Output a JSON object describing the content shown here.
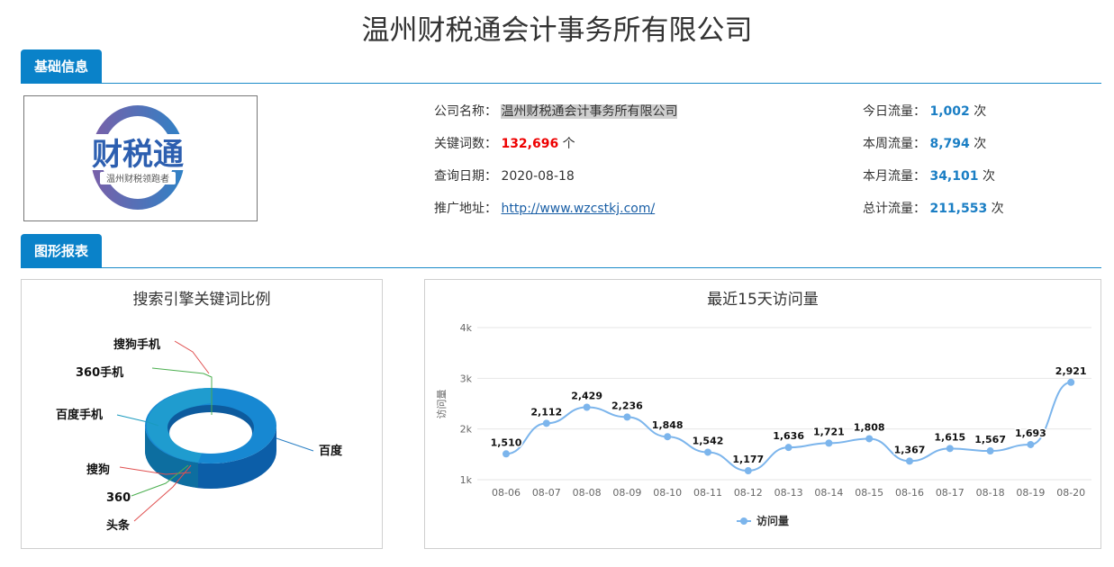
{
  "page": {
    "title": "温州财税通会计事务所有限公司"
  },
  "sections": {
    "basic": "基础信息",
    "charts": "图形报表"
  },
  "logo": {
    "main_text": "财税通",
    "sub_text": "温州财税领跑者",
    "ring_colors": [
      "#7a5fa8",
      "#2f82c6"
    ]
  },
  "basic_info": {
    "company_label": "公司名称：",
    "company_value": "温州财税通会计事务所有限公司",
    "keywords_label": "关键词数：",
    "keywords_value": "132,696",
    "keywords_unit": "个",
    "date_label": "查询日期：",
    "date_value": "2020-08-18",
    "url_label": "推广地址：",
    "url_value": "http://www.wzcstkj.com/"
  },
  "traffic": {
    "today_label": "今日流量：",
    "today_value": "1,002",
    "week_label": "本周流量：",
    "week_value": "8,794",
    "month_label": "本月流量：",
    "month_value": "34,101",
    "total_label": "总计流量：",
    "total_value": "211,553",
    "unit": "次"
  },
  "colors": {
    "accent": "#0a82c9",
    "red": "#ee0000",
    "blue": "#1a7ec4"
  },
  "chart_data": [
    {
      "type": "pie",
      "title": "搜索引擎关键词比例",
      "labels": [
        "百度",
        "百度手机",
        "360手机",
        "搜狗手机",
        "搜狗",
        "360",
        "头条"
      ],
      "values": [
        88,
        5,
        1,
        0.3,
        0.7,
        4,
        1
      ],
      "leader_colors": [
        "#2a7fc4",
        "#1a9abf",
        "#4caf50",
        "#e05050",
        "#e05050",
        "#4caf50",
        "#e05050"
      ]
    },
    {
      "type": "line",
      "title": "最近15天访问量",
      "categories": [
        "08-06",
        "08-07",
        "08-08",
        "08-09",
        "08-10",
        "08-11",
        "08-12",
        "08-13",
        "08-14",
        "08-15",
        "08-16",
        "08-17",
        "08-18",
        "08-19",
        "08-20"
      ],
      "series": [
        {
          "name": "访问量",
          "values": [
            1510,
            2112,
            2429,
            2236,
            1848,
            1542,
            1177,
            1636,
            1721,
            1808,
            1367,
            1615,
            1567,
            1693,
            2921
          ]
        }
      ],
      "ylabel": "访问量",
      "yticks": [
        "1k",
        "2k",
        "3k",
        "4k"
      ],
      "ylim": [
        1000,
        4000
      ],
      "grid": true,
      "legend": "bottom",
      "color": "#7cb5ec"
    }
  ]
}
